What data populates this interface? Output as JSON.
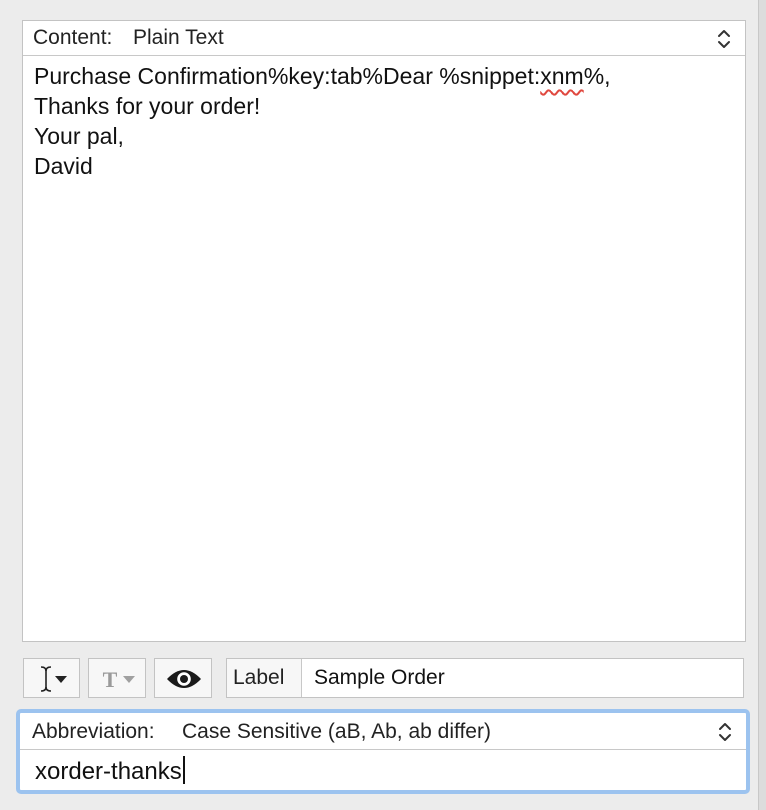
{
  "content": {
    "header_label": "Content:",
    "header_value": "Plain Text",
    "lines": [
      {
        "before": "Purchase Confirmation%key:tab%Dear %snippet:",
        "misspelled": "xnm",
        "after": "%,"
      },
      "Thanks for your order!",
      "Your pal,",
      "David"
    ]
  },
  "toolbar": {
    "insert_icon": "text-cursor-icon",
    "format_icon": "text-format-icon",
    "preview_icon": "eye-icon"
  },
  "label": {
    "title": "Label",
    "value": "Sample Order"
  },
  "abbreviation": {
    "header_label": "Abbreviation:",
    "header_value": "Case Sensitive (aB, Ab, ab differ)",
    "value": "xorder-thanks"
  },
  "colors": {
    "focus_ring": "#9cc3ef",
    "spell_underline": "#e0483f"
  }
}
